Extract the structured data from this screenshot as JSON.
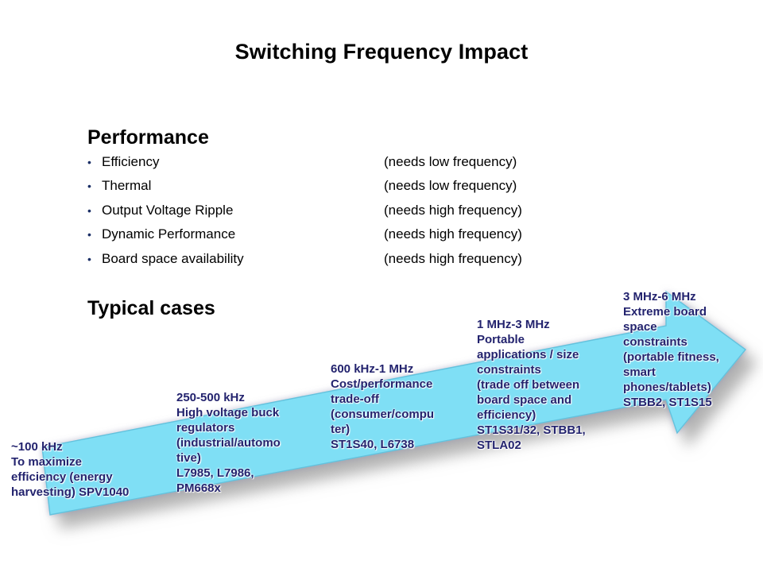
{
  "slide": {
    "title": "Switching Frequency Impact",
    "background_color": "#ffffff"
  },
  "performance": {
    "heading": "Performance",
    "bullet_glyph": "•",
    "bullet_color": "#1b2f66",
    "items": [
      {
        "label": "Efficiency",
        "note": "(needs low frequency)"
      },
      {
        "label": "Thermal",
        "note": "(needs low frequency)"
      },
      {
        "label": "Output Voltage Ripple",
        "note": "(needs high frequency)"
      },
      {
        "label": "Dynamic Performance",
        "note": "(needs high frequency)"
      },
      {
        "label": "Board space availability",
        "note": "(needs high frequency)"
      }
    ]
  },
  "typical_cases": {
    "heading": "Typical cases",
    "arrow": {
      "fill_color": "#7fdff5",
      "stroke_color": "#5bb8d4",
      "shadow_color": "#b0b0b0",
      "direction": "up-right"
    },
    "stages": [
      {
        "id": "stage-100khz",
        "frequency": "~100 kHz",
        "text": "~100 kHz\nTo maximize\nefficiency (energy\nharvesting) SPV1040"
      },
      {
        "id": "stage-250-500khz",
        "frequency": "250-500 kHz",
        "text": "250-500 kHz\nHigh voltage buck\nregulators\n(industrial/automo\ntive)\nL7985, L7986,\nPM668x"
      },
      {
        "id": "stage-600khz-1mhz",
        "frequency": "600 kHz-1 MHz",
        "text": "600 kHz-1 MHz\nCost/performance\ntrade-off\n(consumer/compu\nter)\nST1S40, L6738"
      },
      {
        "id": "stage-1-3mhz",
        "frequency": "1 MHz-3 MHz",
        "text": "1 MHz-3 MHz\nPortable\napplications / size\nconstraints\n(trade off between\nboard space and\nefficiency)\nST1S31/32, STBB1,\nSTLA02"
      },
      {
        "id": "stage-3-6mhz",
        "frequency": "3 MHz-6 MHz",
        "text": "3 MHz-6 MHz\nExtreme board\nspace\nconstraints\n(portable fitness,\nsmart\nphones/tablets)\nSTBB2, ST1S15"
      }
    ]
  }
}
